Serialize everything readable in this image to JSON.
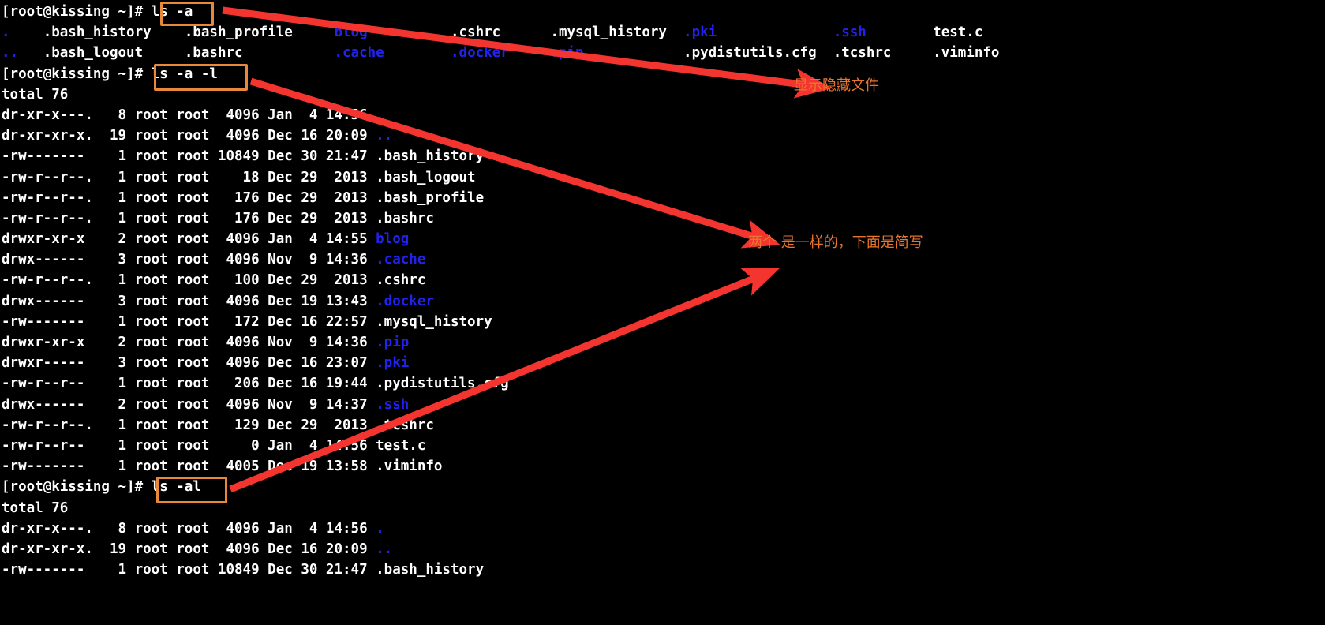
{
  "terminal": {
    "prompt": "[root@kissing ~]# ",
    "hostname": "kissing",
    "user": "root",
    "cwd": "~",
    "colors": {
      "background": "#000000",
      "foreground": "#ffffff",
      "directory": "#2222ee",
      "annotation": "#e8752f",
      "arrow": "#f4352f",
      "highlight_box": "#e8883a"
    },
    "commands": [
      {
        "label": "ls -a",
        "highlighted": true
      },
      {
        "label": "ls -a -l",
        "highlighted": true
      },
      {
        "label": "ls -al",
        "highlighted": true
      }
    ],
    "ls_a_output": [
      [
        {
          "t": ".",
          "type": "dir"
        },
        {
          "t": ".bash_history",
          "type": "file"
        },
        {
          "t": ".bash_profile",
          "type": "file"
        },
        {
          "t": "blog",
          "type": "dir"
        },
        {
          "t": ".cshrc",
          "type": "file"
        },
        {
          "t": ".mysql_history",
          "type": "file"
        },
        {
          "t": ".pki",
          "type": "dir"
        },
        {
          "t": ".ssh",
          "type": "dir"
        },
        {
          "t": "test.c",
          "type": "file"
        }
      ],
      [
        {
          "t": "..",
          "type": "dir"
        },
        {
          "t": ".bash_logout",
          "type": "file"
        },
        {
          "t": ".bashrc",
          "type": "file"
        },
        {
          "t": ".cache",
          "type": "dir"
        },
        {
          "t": ".docker",
          "type": "dir"
        },
        {
          "t": ".pip",
          "type": "dir"
        },
        {
          "t": ".pydistutils.cfg",
          "type": "file"
        },
        {
          "t": ".tcshrc",
          "type": "file"
        },
        {
          "t": ".viminfo",
          "type": "file"
        }
      ]
    ],
    "total_line": "total 76",
    "long_listing": [
      {
        "perms": "dr-xr-x---.",
        "links": "8",
        "owner": "root",
        "group": "root",
        "size": "4096",
        "month": "Jan",
        "day": "4",
        "time": "14:56",
        "name": ".",
        "type": "dir"
      },
      {
        "perms": "dr-xr-xr-x.",
        "links": "19",
        "owner": "root",
        "group": "root",
        "size": "4096",
        "month": "Dec",
        "day": "16",
        "time": "20:09",
        "name": "..",
        "type": "dir"
      },
      {
        "perms": "-rw-------",
        "links": "1",
        "owner": "root",
        "group": "root",
        "size": "10849",
        "month": "Dec",
        "day": "30",
        "time": "21:47",
        "name": ".bash_history",
        "type": "file"
      },
      {
        "perms": "-rw-r--r--.",
        "links": "1",
        "owner": "root",
        "group": "root",
        "size": "18",
        "month": "Dec",
        "day": "29",
        "time": "2013",
        "name": ".bash_logout",
        "type": "file"
      },
      {
        "perms": "-rw-r--r--.",
        "links": "1",
        "owner": "root",
        "group": "root",
        "size": "176",
        "month": "Dec",
        "day": "29",
        "time": "2013",
        "name": ".bash_profile",
        "type": "file"
      },
      {
        "perms": "-rw-r--r--.",
        "links": "1",
        "owner": "root",
        "group": "root",
        "size": "176",
        "month": "Dec",
        "day": "29",
        "time": "2013",
        "name": ".bashrc",
        "type": "file"
      },
      {
        "perms": "drwxr-xr-x",
        "links": "2",
        "owner": "root",
        "group": "root",
        "size": "4096",
        "month": "Jan",
        "day": "4",
        "time": "14:55",
        "name": "blog",
        "type": "dir"
      },
      {
        "perms": "drwx------",
        "links": "3",
        "owner": "root",
        "group": "root",
        "size": "4096",
        "month": "Nov",
        "day": "9",
        "time": "14:36",
        "name": ".cache",
        "type": "dir"
      },
      {
        "perms": "-rw-r--r--.",
        "links": "1",
        "owner": "root",
        "group": "root",
        "size": "100",
        "month": "Dec",
        "day": "29",
        "time": "2013",
        "name": ".cshrc",
        "type": "file"
      },
      {
        "perms": "drwx------",
        "links": "3",
        "owner": "root",
        "group": "root",
        "size": "4096",
        "month": "Dec",
        "day": "19",
        "time": "13:43",
        "name": ".docker",
        "type": "dir"
      },
      {
        "perms": "-rw-------",
        "links": "1",
        "owner": "root",
        "group": "root",
        "size": "172",
        "month": "Dec",
        "day": "16",
        "time": "22:57",
        "name": ".mysql_history",
        "type": "file"
      },
      {
        "perms": "drwxr-xr-x",
        "links": "2",
        "owner": "root",
        "group": "root",
        "size": "4096",
        "month": "Nov",
        "day": "9",
        "time": "14:36",
        "name": ".pip",
        "type": "dir"
      },
      {
        "perms": "drwxr-----",
        "links": "3",
        "owner": "root",
        "group": "root",
        "size": "4096",
        "month": "Dec",
        "day": "16",
        "time": "23:07",
        "name": ".pki",
        "type": "dir"
      },
      {
        "perms": "-rw-r--r--",
        "links": "1",
        "owner": "root",
        "group": "root",
        "size": "206",
        "month": "Dec",
        "day": "16",
        "time": "19:44",
        "name": ".pydistutils.cfg",
        "type": "file"
      },
      {
        "perms": "drwx------",
        "links": "2",
        "owner": "root",
        "group": "root",
        "size": "4096",
        "month": "Nov",
        "day": "9",
        "time": "14:37",
        "name": ".ssh",
        "type": "dir"
      },
      {
        "perms": "-rw-r--r--.",
        "links": "1",
        "owner": "root",
        "group": "root",
        "size": "129",
        "month": "Dec",
        "day": "29",
        "time": "2013",
        "name": ".tcshrc",
        "type": "file"
      },
      {
        "perms": "-rw-r--r--",
        "links": "1",
        "owner": "root",
        "group": "root",
        "size": "0",
        "month": "Jan",
        "day": "4",
        "time": "14:56",
        "name": "test.c",
        "type": "file"
      },
      {
        "perms": "-rw-------",
        "links": "1",
        "owner": "root",
        "group": "root",
        "size": "4005",
        "month": "Dec",
        "day": "19",
        "time": "13:58",
        "name": ".viminfo",
        "type": "file"
      }
    ],
    "long_listing_tail": [
      {
        "perms": "dr-xr-x---.",
        "links": "8",
        "owner": "root",
        "group": "root",
        "size": "4096",
        "month": "Jan",
        "day": "4",
        "time": "14:56",
        "name": ".",
        "type": "dir"
      },
      {
        "perms": "dr-xr-xr-x.",
        "links": "19",
        "owner": "root",
        "group": "root",
        "size": "4096",
        "month": "Dec",
        "day": "16",
        "time": "20:09",
        "name": "..",
        "type": "dir"
      },
      {
        "perms": "-rw-------",
        "links": "1",
        "owner": "root",
        "group": "root",
        "size": "10849",
        "month": "Dec",
        "day": "30",
        "time": "21:47",
        "name": ".bash_history",
        "type": "file"
      }
    ]
  },
  "annotations": [
    {
      "id": "annot-1",
      "text": "显示隐藏文件"
    },
    {
      "id": "annot-2",
      "text": "两个 是一样的，下面是简写"
    }
  ]
}
